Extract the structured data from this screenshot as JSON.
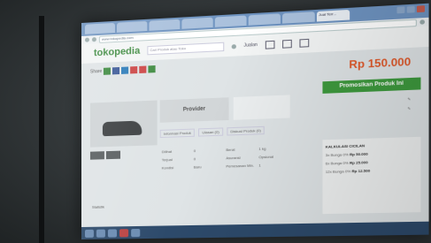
{
  "browser": {
    "tabs": [
      "",
      "",
      "",
      "",
      "",
      "",
      "",
      "Jual Terr..."
    ],
    "url": "www.tokopedia.com"
  },
  "header": {
    "logo": "tokopedia",
    "search_placeholder": "Cari Produk atau Toko",
    "nav_label": "Jualan"
  },
  "product": {
    "title": "Provider",
    "price": "Rp 150.000",
    "promo_button": "Promosikan Produk Ini",
    "share_label": "Share",
    "minitabs": [
      "Informasi Produk",
      "Ulasan (0)",
      "Diskusi Produk (0)"
    ],
    "specs": [
      [
        "Dilihat",
        "0",
        "Berat",
        "1 kg"
      ],
      [
        "Terjual",
        "0",
        "Asuransi",
        "Opsional"
      ],
      [
        "Kondisi",
        "Baru",
        "Pemesanan Min.",
        "1"
      ]
    ],
    "calc_title": "KALKULASI CICILAN",
    "calc_rows": [
      [
        "3x Bunga 0%",
        "Rp 50.000"
      ],
      [
        "6x Bunga 0%",
        "Rp 25.000"
      ],
      [
        "12x Bunga 0%",
        "Rp 12.500"
      ]
    ],
    "stat_link": "Statistik"
  }
}
